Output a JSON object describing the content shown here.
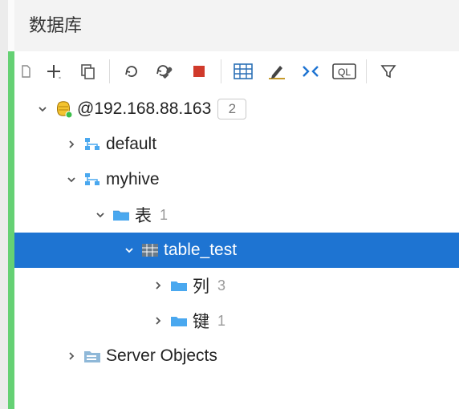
{
  "tab": {
    "title": "数据库"
  },
  "toolbar": {
    "add": "add",
    "copy": "copy",
    "refresh": "refresh",
    "configure": "configure",
    "stop": "stop",
    "grid": "grid",
    "edit": "edit",
    "collapse": "collapse",
    "sql": "QL",
    "filter": "filter"
  },
  "tree": {
    "root": {
      "label": "@192.168.88.163",
      "badge": "2"
    },
    "schemas": [
      {
        "label": "default"
      },
      {
        "label": "myhive",
        "tables_group": {
          "label": "表",
          "count": "1"
        },
        "table": {
          "label": "table_test",
          "columns": {
            "label": "列",
            "count": "3"
          },
          "keys": {
            "label": "键",
            "count": "1"
          }
        }
      }
    ],
    "server_objects": {
      "label": "Server Objects"
    }
  }
}
